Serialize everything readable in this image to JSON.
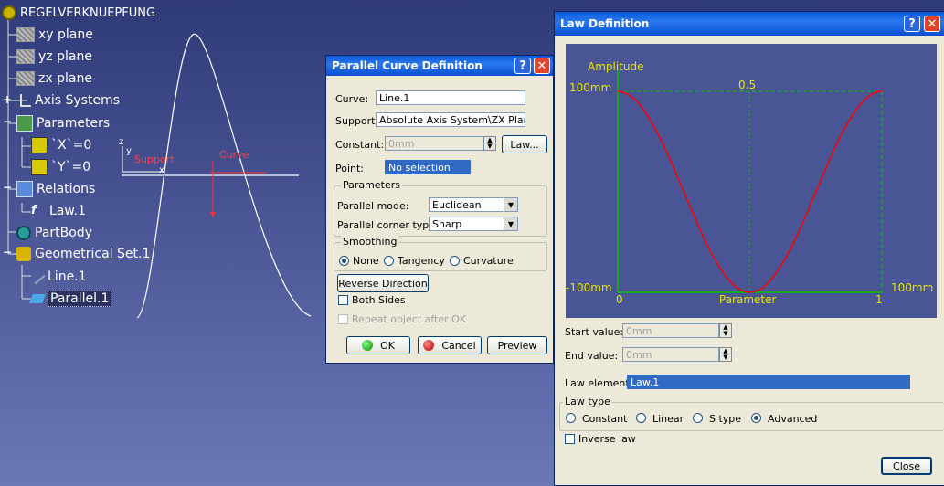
{
  "tree": {
    "root": "REGELVERKNUEPFUNG",
    "items": [
      "xy plane",
      "yz plane",
      "zx plane",
      "Axis Systems",
      "Parameters",
      "`X`=0",
      "`Y`=0",
      "Relations",
      "Law.1",
      "PartBody",
      "Geometrical Set.1",
      "Line.1",
      "Parallel.1"
    ]
  },
  "viewport": {
    "support_label": "Support",
    "curve_label": "Curve",
    "axis_z": "z",
    "axis_y": "y",
    "axis_x": "x"
  },
  "parallel": {
    "title": "Parallel Curve Definition",
    "curve_label": "Curve:",
    "curve_value": "Line.1",
    "support_label": "Support:",
    "support_value": "Absolute Axis System\\ZX Plane",
    "constant_label": "Constant:",
    "constant_value": "0mm",
    "law_button": "Law...",
    "point_label": "Point:",
    "point_value": "No selection",
    "parameters_group": "Parameters",
    "parallel_mode_label": "Parallel mode:",
    "parallel_mode_value": "Euclidean",
    "corner_type_label": "Parallel corner type:",
    "corner_type_value": "Sharp",
    "smoothing_group": "Smoothing",
    "smoothing_options": [
      "None",
      "Tangency",
      "Curvature"
    ],
    "smoothing_selected": "None",
    "reverse_button": "Reverse Direction",
    "both_sides": "Both Sides",
    "repeat_label": "Repeat object after OK",
    "ok": "OK",
    "cancel": "Cancel",
    "preview": "Preview"
  },
  "law": {
    "title": "Law Definition",
    "graph": {
      "ylabel": "Amplitude",
      "ymax_label": "100mm",
      "ymin_label": "-100mm",
      "xmin_label": "0",
      "xmid_label": "0.5",
      "xmax_label": "1",
      "xlabel": "Parameter",
      "right_label": "100mm"
    },
    "start_label": "Start value:",
    "start_value": "0mm",
    "end_label": "End value:",
    "end_value": "0mm",
    "element_label": "Law element:",
    "element_value": "Law.1",
    "type_group": "Law type",
    "type_options": [
      "Constant",
      "Linear",
      "S type",
      "Advanced"
    ],
    "type_selected": "Advanced",
    "inverse_label": "Inverse law",
    "close": "Close"
  },
  "colors": {
    "background": "#4a5596",
    "curve": "#ff0000",
    "graph_axes": "#00c800",
    "graph_text": "#e6e600",
    "title_bar": "#2a78f0"
  }
}
